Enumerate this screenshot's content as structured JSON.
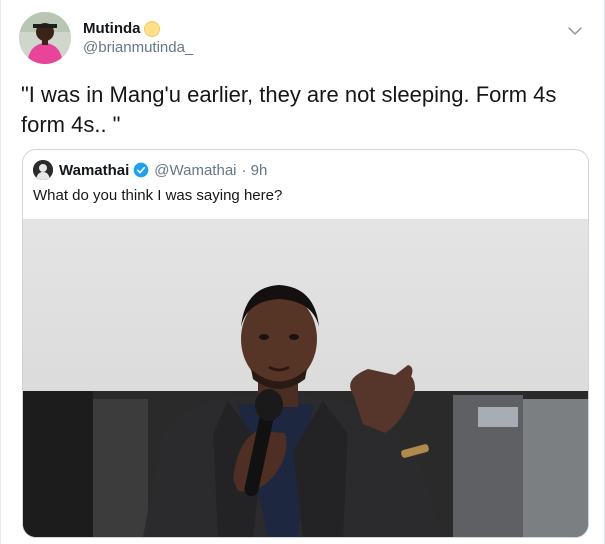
{
  "author": {
    "display_name": "Mutinda",
    "handle": "@brianmutinda_"
  },
  "tweet": {
    "text": "\"I was in Mang'u earlier, they are not sleeping. Form 4s form 4s.. \""
  },
  "quoted_tweet": {
    "display_name": "Wamathai",
    "handle": "@Wamathai",
    "time": "· 9h",
    "text": "What do you think I was saying here?"
  },
  "icons": {
    "menu": "chevron-down-icon",
    "verified": "verified-badge-icon",
    "emoji_badge": "emoji-badge-icon"
  },
  "colors": {
    "verified_blue": "#1da1f2",
    "muted_text": "#657786",
    "border": "#ccd6dd"
  }
}
